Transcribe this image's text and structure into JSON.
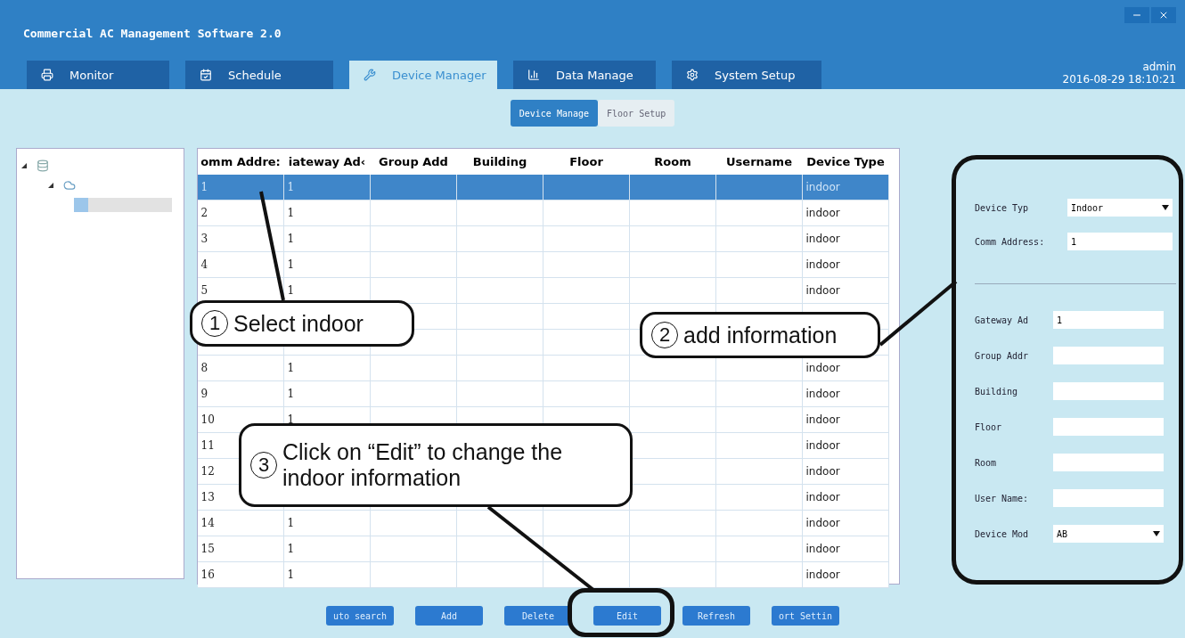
{
  "window": {
    "title": "Commercial AC Management Software 2.0"
  },
  "user": {
    "name": "admin",
    "datetime": "2016-08-29 18:10:21"
  },
  "tabs": [
    {
      "label": "Monitor",
      "selected": false,
      "kind": "monitor"
    },
    {
      "label": "Schedule",
      "selected": false,
      "kind": "schedule"
    },
    {
      "label": "Device Manager",
      "selected": true,
      "kind": "device"
    },
    {
      "label": "Data Manage",
      "selected": false,
      "kind": "data"
    },
    {
      "label": "System Setup",
      "selected": false,
      "kind": "setup"
    }
  ],
  "subtabs": [
    {
      "label": "Device Manage",
      "selected": true
    },
    {
      "label": "Floor Setup",
      "selected": false
    }
  ],
  "tree": [
    {
      "expanded": true,
      "children": [
        {
          "expanded": true,
          "children": [
            {
              "selected": true
            }
          ]
        }
      ]
    }
  ],
  "table": {
    "columns": [
      "omm Addre:",
      "iateway Ad‹",
      "Group Add",
      "Building",
      "Floor",
      "Room",
      "Username",
      "Device Type"
    ],
    "rows": [
      {
        "selected": true,
        "cells": [
          "1",
          "1",
          "",
          "",
          "",
          "",
          "",
          "indoor"
        ]
      },
      {
        "selected": false,
        "cells": [
          "2",
          "1",
          "",
          "",
          "",
          "",
          "",
          "indoor"
        ]
      },
      {
        "selected": false,
        "cells": [
          "3",
          "1",
          "",
          "",
          "",
          "",
          "",
          "indoor"
        ]
      },
      {
        "selected": false,
        "cells": [
          "4",
          "1",
          "",
          "",
          "",
          "",
          "",
          "indoor"
        ]
      },
      {
        "selected": false,
        "cells": [
          "5",
          "1",
          "",
          "",
          "",
          "",
          "",
          "indoor"
        ]
      },
      {
        "selected": false,
        "cells": [
          "",
          "",
          "",
          "",
          "",
          "",
          "",
          ""
        ]
      },
      {
        "selected": false,
        "cells": [
          "",
          "",
          "",
          "",
          "",
          "",
          "",
          ""
        ]
      },
      {
        "selected": false,
        "cells": [
          "8",
          "1",
          "",
          "",
          "",
          "",
          "",
          "indoor"
        ]
      },
      {
        "selected": false,
        "cells": [
          "9",
          "1",
          "",
          "",
          "",
          "",
          "",
          "indoor"
        ]
      },
      {
        "selected": false,
        "cells": [
          "10",
          "1",
          "",
          "",
          "",
          "",
          "",
          "indoor"
        ]
      },
      {
        "selected": false,
        "cells": [
          "11",
          "",
          "",
          "",
          "",
          "",
          "",
          "indoor"
        ]
      },
      {
        "selected": false,
        "cells": [
          "12",
          "",
          "",
          "",
          "",
          "",
          "",
          "indoor"
        ]
      },
      {
        "selected": false,
        "cells": [
          "13",
          "",
          "",
          "",
          "",
          "",
          "",
          "indoor"
        ]
      },
      {
        "selected": false,
        "cells": [
          "14",
          "1",
          "",
          "",
          "",
          "",
          "",
          "indoor"
        ]
      },
      {
        "selected": false,
        "cells": [
          "15",
          "1",
          "",
          "",
          "",
          "",
          "",
          "indoor"
        ]
      },
      {
        "selected": false,
        "cells": [
          "16",
          "1",
          "",
          "",
          "",
          "",
          "",
          "indoor"
        ]
      }
    ]
  },
  "form": {
    "groups": [
      [
        {
          "label": "Device Typ",
          "kind": "select",
          "value": "Indoor"
        },
        {
          "label": "Comm Address:",
          "kind": "input",
          "value": "1"
        }
      ],
      [
        {
          "label": "Gateway Ad",
          "kind": "input",
          "value": "1"
        },
        {
          "label": "Group Addr",
          "kind": "input"
        },
        {
          "label": "Building",
          "kind": "input"
        },
        {
          "label": "Floor",
          "kind": "input"
        },
        {
          "label": "Room",
          "kind": "input"
        },
        {
          "label": "User Name:",
          "kind": "input"
        },
        {
          "label": "Device Mod",
          "kind": "select",
          "value": "AB"
        }
      ]
    ]
  },
  "buttons": [
    "uto search",
    "Add",
    "Delete",
    "Edit",
    "Refresh",
    "ort Settin"
  ],
  "callouts": [
    {
      "number": "1",
      "text": "Select indoor"
    },
    {
      "number": "2",
      "text": "add information"
    },
    {
      "number": "3",
      "text": "Click on “Edit” to change the indoor information"
    }
  ]
}
